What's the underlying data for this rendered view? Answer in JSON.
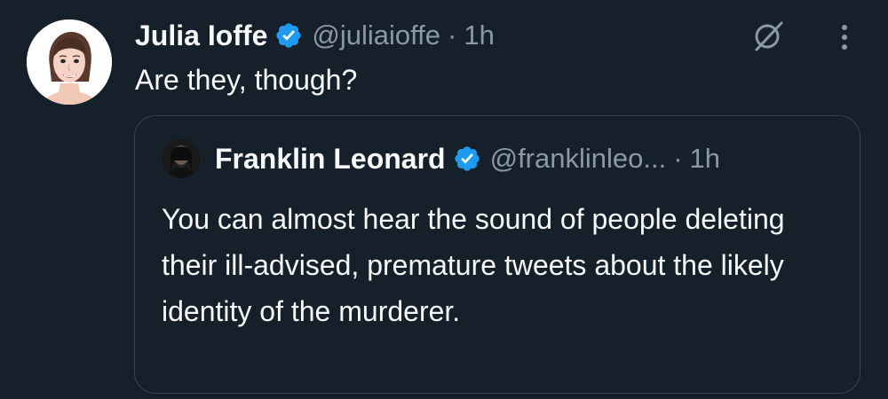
{
  "theme": {
    "background": "#15202b",
    "text_primary": "#f7f9f9",
    "text_secondary": "#8b98a5",
    "verified_blue": "#1d9bf0",
    "border": "#38444d"
  },
  "tweet": {
    "author_name": "Julia Ioffe",
    "author_handle": "@juliaioffe",
    "separator": "·",
    "time": "1h",
    "text": "Are they, though?",
    "verified_icon": "verified-badge-icon",
    "grok_icon": "grok-icon",
    "more_icon": "more-vertical-icon"
  },
  "quoted_tweet": {
    "author_name": "Franklin Leonard",
    "author_handle": "@franklinleo...",
    "separator": "·",
    "time": "1h",
    "text": "You can almost hear the sound of people deleting their ill-advised, premature tweets about the likely identity of the murderer.",
    "verified_icon": "verified-badge-icon"
  }
}
